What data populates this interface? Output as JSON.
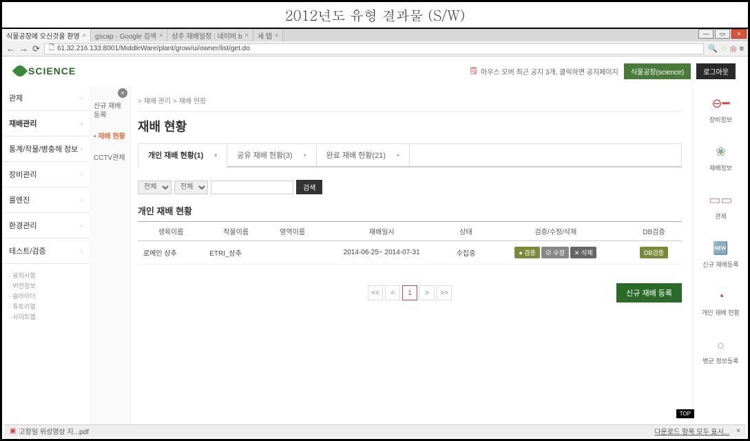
{
  "doc_title": "2012년도 유형 결과물 (S/W)",
  "browser": {
    "tabs": [
      {
        "label": "식물공장에 오신것을 환영"
      },
      {
        "label": "gscap - Google 검색"
      },
      {
        "label": "상주 재배일정 : 네이버 b"
      },
      {
        "label": "새 탭"
      }
    ],
    "url": "61.32.216.133:8001/MiddleWare/plant/grow/ui/owner/list/get.do"
  },
  "header": {
    "logo": "SCIENCE",
    "notice_prefix": "마우스 오버 최근 공지 3개, 클릭하면 공지페이지",
    "btn_app": "식물공장(science)",
    "btn_logout": "로그아웃"
  },
  "sidebar": {
    "items": [
      {
        "label": "관제"
      },
      {
        "label": "재배관리"
      },
      {
        "label": "통계/작물/병충해 정보"
      },
      {
        "label": "장비관리"
      },
      {
        "label": "룰엔진"
      },
      {
        "label": "환경관리"
      },
      {
        "label": "테스트/검증"
      }
    ],
    "footer": [
      "· 공지사항",
      "· 버전정보",
      "· 슬라이더",
      "· 튜토리얼",
      "· 사이트맵"
    ]
  },
  "sub_sidebar": {
    "items": [
      {
        "label": "신규 재배 등록"
      },
      {
        "label": "재배 현황",
        "active": true
      },
      {
        "label": "CCTV관제"
      }
    ]
  },
  "breadcrumb": "> 재배 관리 > 재배 현황",
  "page_title": "재배 현황",
  "tabs": [
    {
      "label": "개인 재배 현황(1)",
      "active": true
    },
    {
      "label": "공유 재배 현황(3)"
    },
    {
      "label": "완료 재배 현황(21)"
    }
  ],
  "filter": {
    "sel1": "전체",
    "sel2": "전체",
    "search_btn": "검색"
  },
  "table": {
    "title": "개인 재배 현황",
    "headers": [
      "생육이름",
      "작물이름",
      "영역이름",
      "재배일시",
      "상태",
      "검증/수정/삭제",
      "DB검증"
    ],
    "rows": [
      {
        "grow": "로메인 상추",
        "crop": "ETRI_상추",
        "area": "",
        "date": "2014-06-25~ 2014-07-31",
        "status": "수집중",
        "act1": "● 검증",
        "act2": "⊘ 수정",
        "act3": "✕ 삭제",
        "db": "DB검증"
      }
    ]
  },
  "pager": {
    "first": "<<",
    "prev": "<",
    "page": "1",
    "next": ">",
    "last": ">>"
  },
  "btn_new": "신규 재배 등록",
  "rail": [
    {
      "label": "장비정보",
      "icon": "⊖━"
    },
    {
      "label": "재배정보",
      "icon": "❀"
    },
    {
      "label": "관제",
      "icon": "▭▭"
    },
    {
      "label": "신규 재배등록",
      "icon": "🆕"
    },
    {
      "label": "개인 재배 현황",
      "icon": "◔"
    },
    {
      "label": "병균 정보등록",
      "icon": "☼"
    }
  ],
  "bottom": {
    "file": "고장일 위성영상 지...pdf",
    "dl": "다운로드 항목 모두 표시...",
    "dl_x": "×"
  },
  "top_badge": "TOP"
}
